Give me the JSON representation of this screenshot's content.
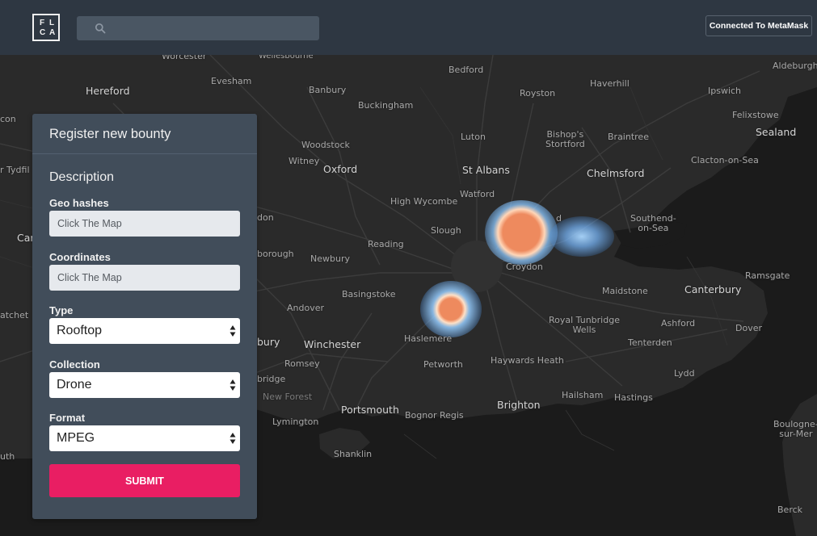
{
  "header": {
    "logo_letters": [
      "F",
      "L",
      "C",
      "A"
    ],
    "search": {
      "value": "",
      "placeholder": ""
    },
    "wallet_button": "Connected To MetaMask"
  },
  "map": {
    "places": {
      "worcester": "Worcester",
      "wellesbourne": "Wellesbourne",
      "hereford": "Hereford",
      "evesham": "Evesham",
      "banbury": "Banbury",
      "bedford": "Bedford",
      "haverhill": "Haverhill",
      "aldeburgh": "Aldeburgh",
      "ipswich": "Ipswich",
      "royston": "Royston",
      "buckingham": "Buckingham",
      "felixstowe": "Felixstowe",
      "sealand": "Sealand",
      "bishops_stortford": "Bishop's\nStortford",
      "braintree": "Braintree",
      "luton": "Luton",
      "woodstock": "Woodstock",
      "witney": "Witney",
      "oxford": "Oxford",
      "st_albans": "St Albans",
      "chelmsford": "Chelmsford",
      "clacton": "Clacton-on-Sea",
      "watford": "Watford",
      "high_wycombe": "High Wycombe",
      "southend": "Southend-\non-Sea",
      "slough": "Slough",
      "reading": "Reading",
      "newbury": "Newbury",
      "croydon": "Croydon",
      "ramsgate": "Ramsgate",
      "basingstoke": "Basingstoke",
      "maidstone": "Maidstone",
      "canterbury": "Canterbury",
      "andover": "Andover",
      "royal_tunbridge": "Royal Tunbridge\nWells",
      "ashford": "Ashford",
      "dover": "Dover",
      "haslemere": "Haslemere",
      "winchester": "Winchester",
      "tenterden": "Tenterden",
      "romsey": "Romsey",
      "haywards_heath": "Haywards Heath",
      "petworth": "Petworth",
      "lydd": "Lydd",
      "new_forest": "New Forest",
      "hailsham": "Hailsham",
      "hastings": "Hastings",
      "brighton": "Brighton",
      "portsmouth": "Portsmouth",
      "bognor_regis": "Bognor Regis",
      "lymington": "Lymington",
      "boulogne": "Boulogne-\nsur-Mer",
      "shanklin": "Shanklin",
      "berck": "Berck",
      "edge_con": "con",
      "edge_tydfil": "r Tydfil",
      "edge_don": "don",
      "edge_car": "Car",
      "edge_borough": "borough",
      "edge_atchet": "atchet",
      "edge_bury": "bury",
      "edge_bridge": "bridge",
      "edge_uth": "uth",
      "edge_d": "d"
    }
  },
  "panel": {
    "title": "Register new bounty",
    "section": "Description",
    "geo_hashes": {
      "label": "Geo hashes",
      "placeholder": "Click The Map",
      "value": ""
    },
    "coordinates": {
      "label": "Coordinates",
      "placeholder": "Click The Map",
      "value": ""
    },
    "type": {
      "label": "Type",
      "value": "Rooftop"
    },
    "collection": {
      "label": "Collection",
      "value": "Drone"
    },
    "format": {
      "label": "Format",
      "value": "MPEG"
    },
    "submit_label": "SUBMIT"
  },
  "colors": {
    "header_bg": "#2e3742",
    "panel_bg": "#414d5a",
    "accent": "#e91e63",
    "heat_core": "#ee8a5e",
    "heat_glow": "#7ec3ff"
  }
}
